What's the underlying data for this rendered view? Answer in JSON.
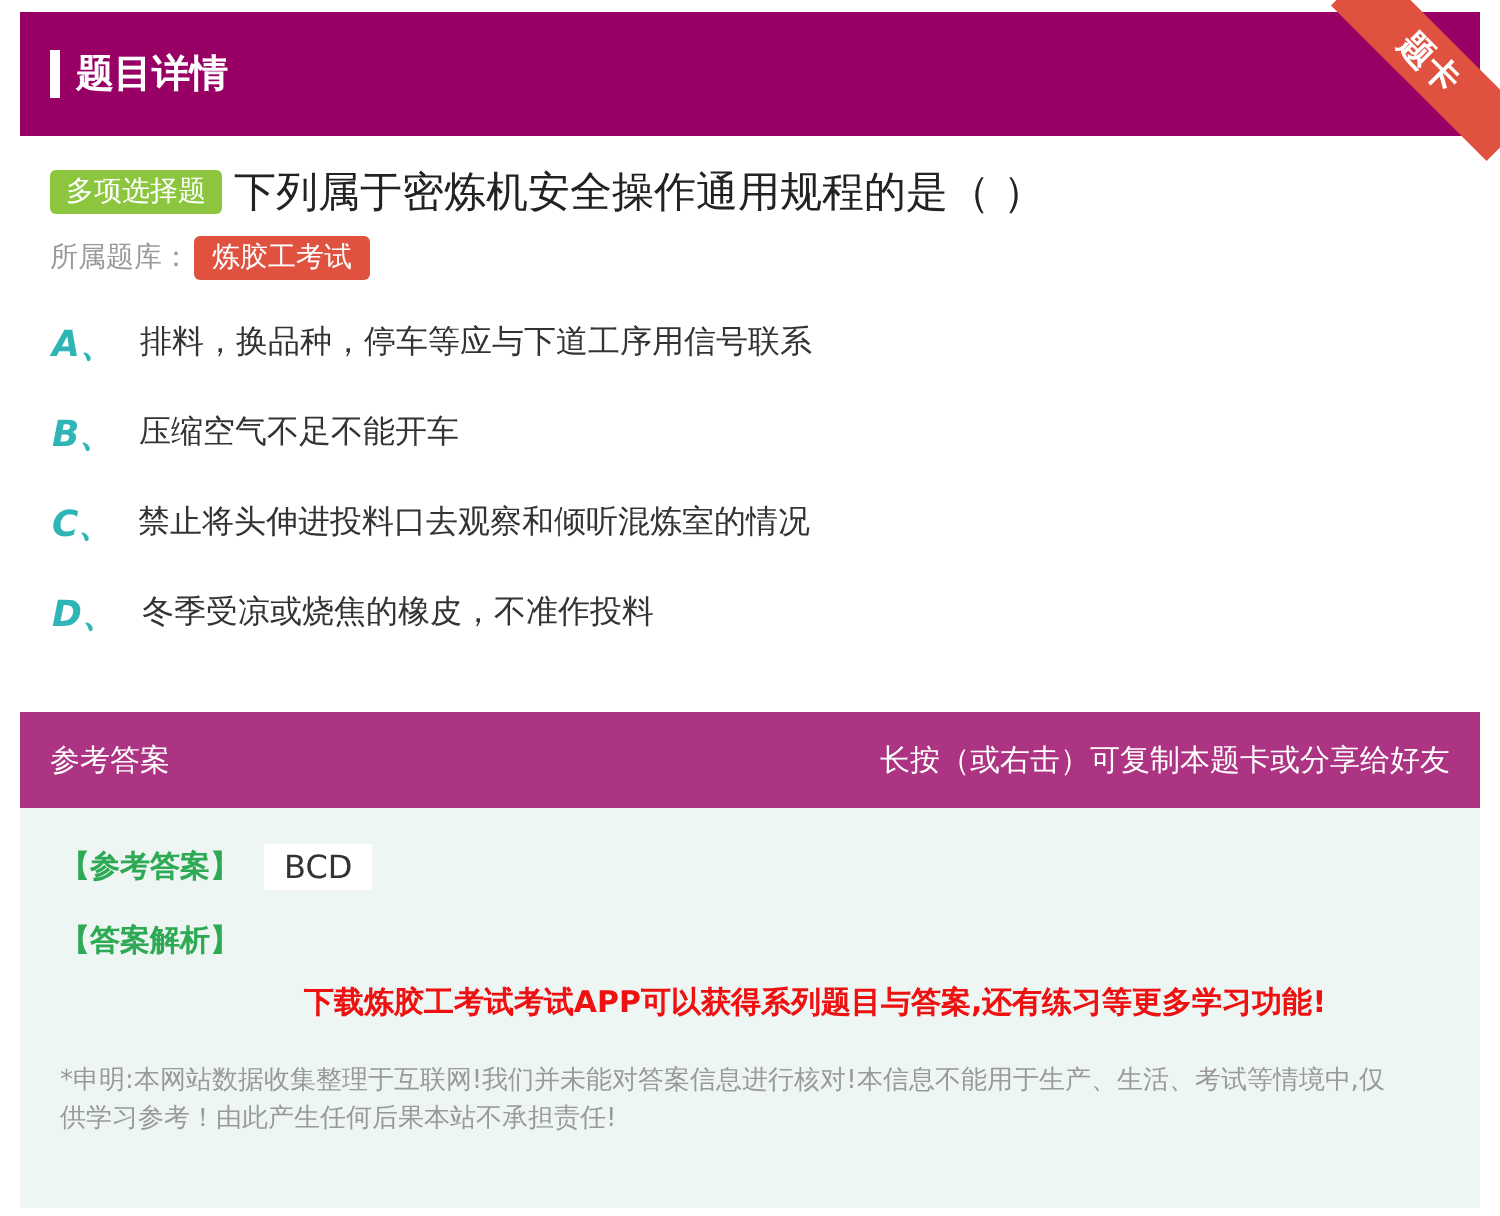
{
  "header": {
    "title": "题目详情",
    "ribbon": "题卡"
  },
  "question": {
    "type_badge": "多项选择题",
    "text": "下列属于密炼机安全操作通用规程的是（ ）",
    "bank_label": "所属题库：",
    "bank": "炼胶工考试"
  },
  "options": [
    {
      "letter": "A、",
      "text": "排料，换品种，停车等应与下道工序用信号联系"
    },
    {
      "letter": "B、",
      "text": "压缩空气不足不能开车"
    },
    {
      "letter": "C、",
      "text": "禁止将头伸进投料口去观察和倾听混炼室的情况"
    },
    {
      "letter": "D、",
      "text": "冬季受凉或烧焦的橡皮，不准作投料"
    }
  ],
  "answer_panel": {
    "title": "参考答案",
    "hint": "长按（或右击）可复制本题卡或分享给好友",
    "answer_label": "【参考答案】",
    "answer": "BCD",
    "analysis_label": "【答案解析】",
    "promo": "下载炼胶工考试考试APP可以获得系列题目与答案,还有练习等更多学习功能!",
    "disclaimer": "*申明:本网站数据收集整理于互联网!我们并未能对答案信息进行核对!本信息不能用于生产、生活、考试等情境中,仅供学习参考！由此产生任何后果本站不承担责任!"
  }
}
